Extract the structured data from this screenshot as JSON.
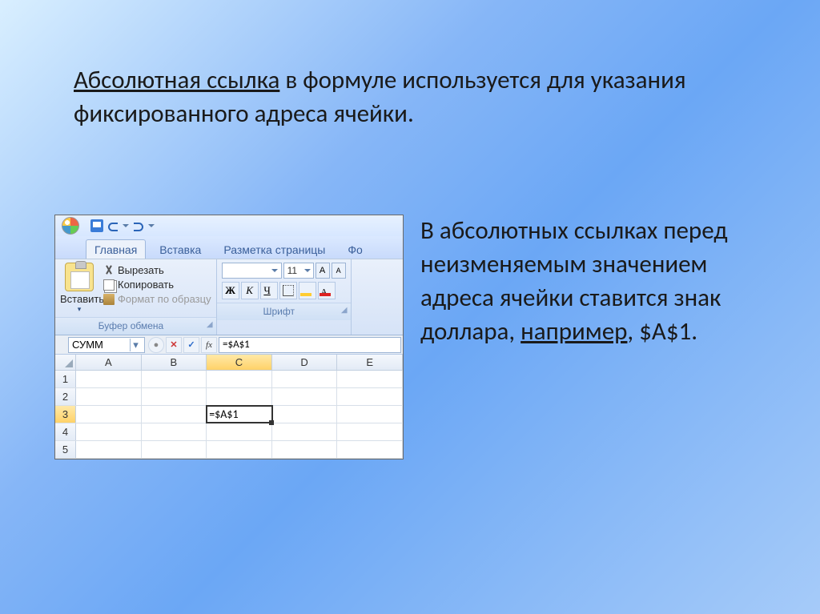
{
  "top": {
    "lead": "Абсолютная ссылка",
    "rest": " в формуле используется для указания фиксированного адреса ячейки."
  },
  "right": {
    "part1": "В абсолютных ссылках перед неизменяемым значением адреса ячейки ставится знак доллара, ",
    "example_word": "например",
    "part2": ", $A$1."
  },
  "excel": {
    "tabs": {
      "home": "Главная",
      "insert": "Вставка",
      "layout": "Разметка страницы",
      "formulas": "Фо"
    },
    "clipboard": {
      "paste": "Вставить",
      "cut": "Вырезать",
      "copy": "Копировать",
      "format_painter": "Формат по образцу",
      "group_label": "Буфер обмена"
    },
    "font": {
      "size": "11",
      "bold": "Ж",
      "italic": "К",
      "underline": "Ч",
      "group_label": "Шрифт"
    },
    "namebox": "СУММ",
    "formula": "=$A$1",
    "columns": [
      "A",
      "B",
      "C",
      "D",
      "E"
    ],
    "rows": [
      "1",
      "2",
      "3",
      "4",
      "5"
    ],
    "active_cell_value": "=$A$1"
  }
}
